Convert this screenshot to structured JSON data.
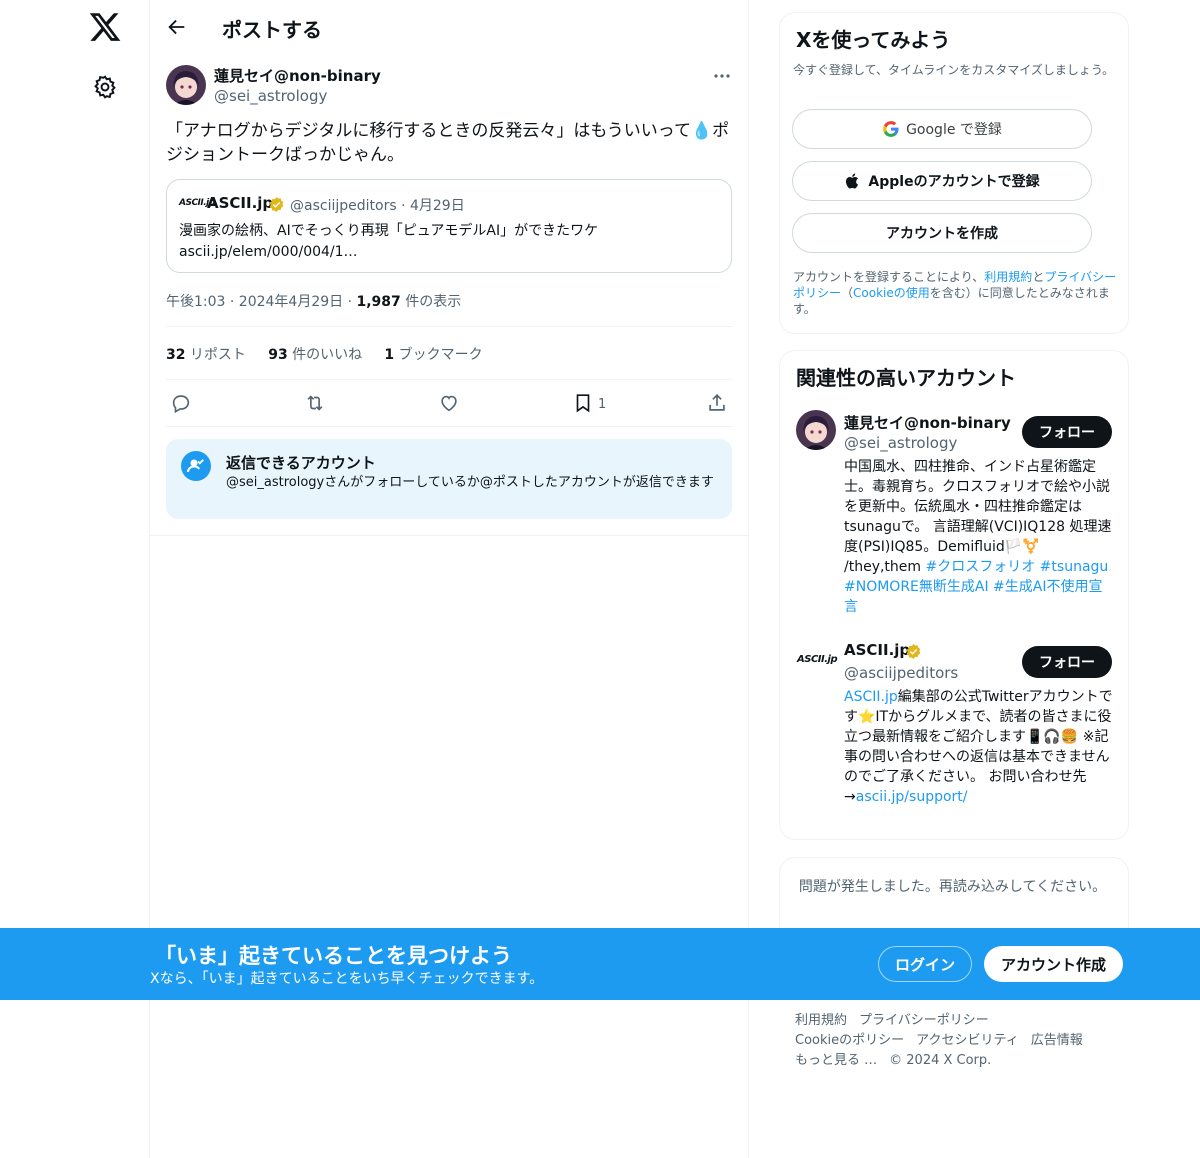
{
  "nav": {
    "logo_icon": "x-logo-icon",
    "settings_icon": "gear-icon"
  },
  "header": {
    "title": "ポストする",
    "back_icon": "arrow-left-icon"
  },
  "post": {
    "author_name": "蓮見セイ@non-binary",
    "author_handle": "@sei_astrology",
    "text": "「アナログからデジタルに移行するときの反発云々」はもういいって💧ポジショントークばっかじゃん。",
    "quote": {
      "logo_text": "ASCII.jp",
      "name": "ASCII.jp",
      "handle_date": "@asciijpeditors · 4月29日",
      "text": "漫画家の絵柄、AIでそっくり再現「ピュアモデルAI」ができたワケ",
      "url": "ascii.jp/elem/000/004/1…"
    },
    "meta_time": "午後1:03 · 2024年4月29日 · ",
    "views_count": "1,987",
    "views_label": " 件の表示",
    "stats": {
      "reposts_count": "32",
      "reposts_label": " リポスト",
      "likes_count": "93",
      "likes_label": " 件のいいね",
      "bookmarks_count": "1",
      "bookmarks_label": " ブックマーク"
    },
    "bookmark_action_count": "1",
    "reply_restriction": {
      "title": "返信できるアカウント",
      "description": "@sei_astrologyさんがフォローしているか@ポストしたアカウントが返信できます"
    }
  },
  "signup": {
    "title": "Xを使ってみよう",
    "subtitle": "今すぐ登録して、タイムラインをカスタマイズしましょう。",
    "google_label": "Google で登録",
    "apple_label": "Appleのアカウントで登録",
    "create_label": "アカウントを作成",
    "legal_1": "アカウントを登録することにより、",
    "legal_terms": "利用規約",
    "legal_2": "と",
    "legal_privacy": "プライバシーポリシー",
    "legal_3": "（",
    "legal_cookie": "Cookieの使用",
    "legal_4": "を含む）に同意したとみなされます。"
  },
  "related": {
    "title": "関連性の高いアカウント",
    "accounts": [
      {
        "name": "蓮見セイ@non-binary",
        "handle": "@sei_astrology",
        "bio_text": "中国風水、四柱推命、インド占星術鑑定士。毒親育ち。クロスフォリオで絵や小説を更新中。伝統風水・四柱推命鑑定はtsunaguで。 言語理解(VCI)IQ128 処理速度(PSI)IQ85。Demifluid🏳️⚧️ /they,them ",
        "bio_tags": "#クロスフォリオ #tsunagu #NOMORE無断生成AI #生成AI不使用宣言",
        "follow_label": "フォロー"
      },
      {
        "logo_text": "ASCII.jp",
        "name": "ASCII.jp",
        "handle": "@asciijpeditors",
        "bio_link": "ASCII.jp",
        "bio_text": "編集部の公式Twitterアカウントです⭐ITからグルメまで、読者の皆さまに役立つ最新情報をご紹介します📱🎧🍔 ※記事の問い合わせへの返信は基本できませんのでご了承ください。 お問い合わせ先→",
        "bio_url": "ascii.jp/support/",
        "follow_label": "フォロー"
      }
    ]
  },
  "error": {
    "text": "問題が発生しました。再読み込みしてください。"
  },
  "footer": {
    "links": [
      "利用規約",
      "プライバシーポリシー",
      "Cookieのポリシー",
      "アクセシビリティ",
      "広告情報",
      "もっと見る …",
      "© 2024 X Corp."
    ]
  },
  "banner": {
    "title": "「いま」起きていることを見つけよう",
    "subtitle": "Xなら、「いま」起きていることをいち早くチェックできます。",
    "login_label": "ログイン",
    "signup_label": "アカウント作成"
  },
  "colors": {
    "accent": "#1d9bf0",
    "text": "#0f1419",
    "muted": "#536471",
    "border": "#eff3f4",
    "verified": "#e2b719"
  }
}
